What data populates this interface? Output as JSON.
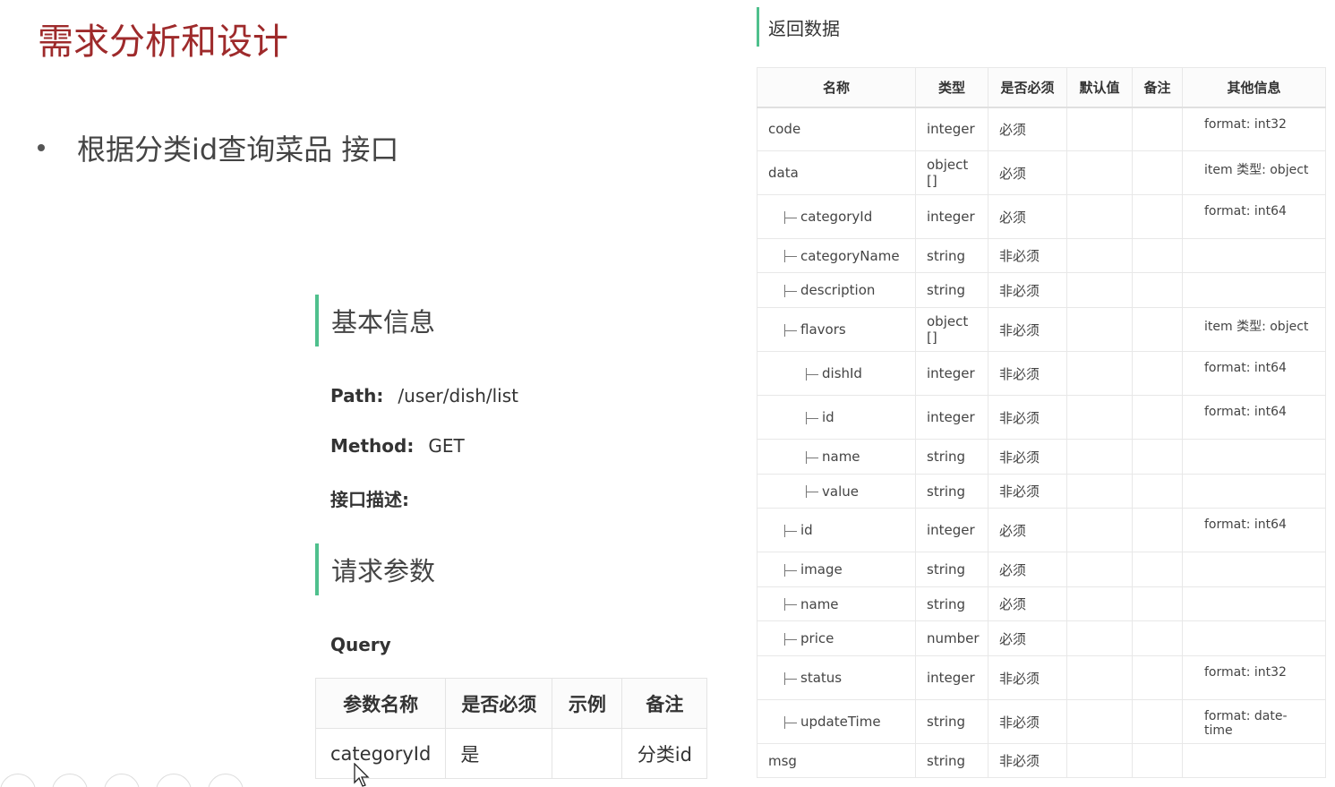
{
  "slide": {
    "title": "需求分析和设计",
    "bullet": "根据分类id查询菜品 接口"
  },
  "basic": {
    "heading": "基本信息",
    "path_label": "Path:",
    "path_value": "/user/dish/list",
    "method_label": "Method:",
    "method_value": "GET",
    "desc_label": "接口描述:"
  },
  "request": {
    "heading": "请求参数",
    "query_label": "Query",
    "columns": [
      "参数名称",
      "是否必须",
      "示例",
      "备注"
    ],
    "rows": [
      {
        "name": "categoryId",
        "required": "是",
        "example": "",
        "note": "分类id"
      }
    ]
  },
  "response": {
    "heading": "返回数据",
    "columns": [
      "名称",
      "类型",
      "是否必须",
      "默认值",
      "备注",
      "其他信息"
    ],
    "rows": [
      {
        "name": "code",
        "type": "integer",
        "required": "必须",
        "default": "",
        "note": "",
        "other": "format: int32"
      },
      {
        "name": "data",
        "type": "object []",
        "required": "必须",
        "default": "",
        "note": "",
        "other": "item 类型: object"
      },
      {
        "name": "categoryId",
        "type": "integer",
        "required": "必须",
        "default": "",
        "note": "",
        "other": "format: int64"
      },
      {
        "name": "categoryName",
        "type": "string",
        "required": "非必须",
        "default": "",
        "note": "",
        "other": ""
      },
      {
        "name": "description",
        "type": "string",
        "required": "非必须",
        "default": "",
        "note": "",
        "other": ""
      },
      {
        "name": "flavors",
        "type": "object []",
        "required": "非必须",
        "default": "",
        "note": "",
        "other": "item 类型: object"
      },
      {
        "name": "dishId",
        "type": "integer",
        "required": "非必须",
        "default": "",
        "note": "",
        "other": "format: int64"
      },
      {
        "name": "id",
        "type": "integer",
        "required": "非必须",
        "default": "",
        "note": "",
        "other": "format: int64"
      },
      {
        "name": "name",
        "type": "string",
        "required": "非必须",
        "default": "",
        "note": "",
        "other": ""
      },
      {
        "name": "value",
        "type": "string",
        "required": "非必须",
        "default": "",
        "note": "",
        "other": ""
      },
      {
        "name": "id",
        "type": "integer",
        "required": "必须",
        "default": "",
        "note": "",
        "other": "format: int64"
      },
      {
        "name": "image",
        "type": "string",
        "required": "必须",
        "default": "",
        "note": "",
        "other": ""
      },
      {
        "name": "name",
        "type": "string",
        "required": "必须",
        "default": "",
        "note": "",
        "other": ""
      },
      {
        "name": "price",
        "type": "number",
        "required": "必须",
        "default": "",
        "note": "",
        "other": ""
      },
      {
        "name": "status",
        "type": "integer",
        "required": "非必须",
        "default": "",
        "note": "",
        "other": "format: int32"
      },
      {
        "name": "updateTime",
        "type": "string",
        "required": "非必须",
        "default": "",
        "note": "",
        "other": "format: date-time"
      },
      {
        "name": "msg",
        "type": "string",
        "required": "非必须",
        "default": "",
        "note": "",
        "other": ""
      }
    ]
  },
  "colors": {
    "title": "#9e2a2b",
    "accent_bar": "#4fc08d"
  }
}
